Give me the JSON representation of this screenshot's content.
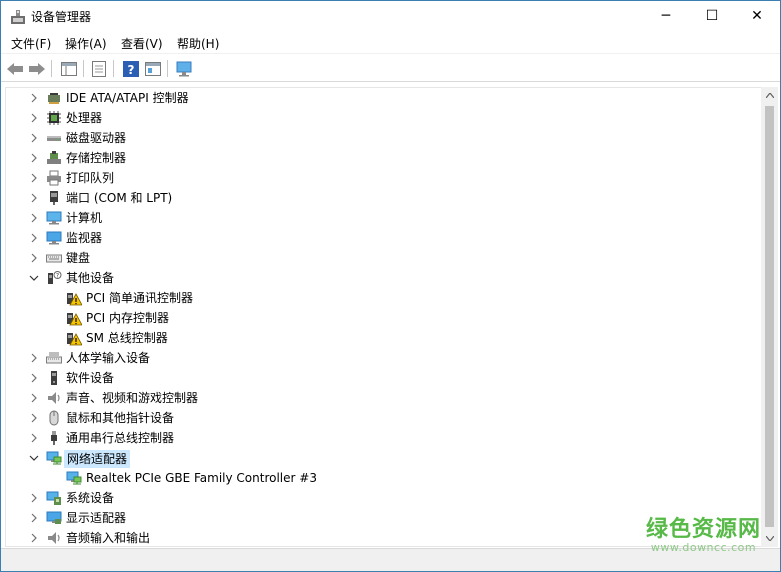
{
  "window": {
    "title": "设备管理器",
    "minimize_glyph": "─",
    "maximize_glyph": "☐",
    "close_glyph": "✕"
  },
  "menu": [
    "文件(F)",
    "操作(A)",
    "查看(V)",
    "帮助(H)"
  ],
  "toolbar": {
    "buttons": [
      "back-arrow-icon",
      "forward-arrow-icon",
      "show-hide-console-tree-icon",
      "properties-icon",
      "help-icon",
      "view-icon",
      "scan-hardware-icon"
    ]
  },
  "tree": {
    "items": [
      {
        "label": "IDE ATA/ATAPI 控制器",
        "icon": "ide-controller-icon",
        "expanded": false,
        "level": 0
      },
      {
        "label": "处理器",
        "icon": "processor-icon",
        "expanded": false,
        "level": 0
      },
      {
        "label": "磁盘驱动器",
        "icon": "disk-drive-icon",
        "expanded": false,
        "level": 0
      },
      {
        "label": "存储控制器",
        "icon": "storage-controller-icon",
        "expanded": false,
        "level": 0
      },
      {
        "label": "打印队列",
        "icon": "printer-icon",
        "expanded": false,
        "level": 0
      },
      {
        "label": "端口 (COM 和 LPT)",
        "icon": "port-icon",
        "expanded": false,
        "level": 0
      },
      {
        "label": "计算机",
        "icon": "computer-icon",
        "expanded": false,
        "level": 0
      },
      {
        "label": "监视器",
        "icon": "monitor-icon",
        "expanded": false,
        "level": 0
      },
      {
        "label": "键盘",
        "icon": "keyboard-icon",
        "expanded": false,
        "level": 0
      },
      {
        "label": "其他设备",
        "icon": "other-devices-icon",
        "expanded": true,
        "level": 0
      },
      {
        "label": "PCI 简单通讯控制器",
        "icon": "warning-device-icon",
        "level": 1
      },
      {
        "label": "PCI 内存控制器",
        "icon": "warning-device-icon",
        "level": 1
      },
      {
        "label": "SM 总线控制器",
        "icon": "warning-device-icon",
        "level": 1
      },
      {
        "label": "人体学输入设备",
        "icon": "hid-icon",
        "expanded": false,
        "level": 0
      },
      {
        "label": "软件设备",
        "icon": "software-device-icon",
        "expanded": false,
        "level": 0
      },
      {
        "label": "声音、视频和游戏控制器",
        "icon": "sound-icon",
        "expanded": false,
        "level": 0
      },
      {
        "label": "鼠标和其他指针设备",
        "icon": "mouse-icon",
        "expanded": false,
        "level": 0
      },
      {
        "label": "通用串行总线控制器",
        "icon": "usb-icon",
        "expanded": false,
        "level": 0
      },
      {
        "label": "网络适配器",
        "icon": "network-adapter-icon",
        "expanded": true,
        "level": 0,
        "selected": true
      },
      {
        "label": "Realtek PCIe GBE Family Controller #3",
        "icon": "network-adapter-icon",
        "level": 1
      },
      {
        "label": "系统设备",
        "icon": "system-device-icon",
        "expanded": false,
        "level": 0
      },
      {
        "label": "显示适配器",
        "icon": "display-adapter-icon",
        "expanded": false,
        "level": 0
      },
      {
        "label": "音频输入和输出",
        "icon": "audio-io-icon",
        "expanded": false,
        "level": 0
      }
    ]
  },
  "watermark": {
    "text": "绿色资源网",
    "url": "www.downcc.com"
  },
  "colors": {
    "selection": "#cce8ff",
    "watermark_green": "#57b947",
    "warning": "#f5c400"
  }
}
